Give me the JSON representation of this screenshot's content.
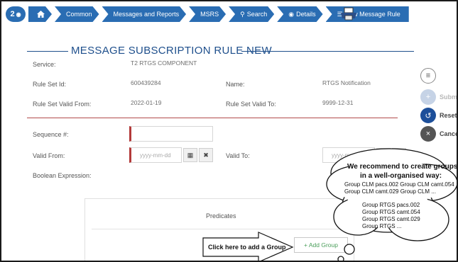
{
  "breadcrumb": {
    "step_number": "2",
    "items": [
      "Common",
      "Messages and Reports",
      "MSRS",
      "Search",
      "Details",
      "New Message Rule"
    ]
  },
  "page": {
    "title": "MESSAGE SUBSCRIPTION RULE NEW"
  },
  "fields": {
    "service_label": "Service:",
    "service_value": "T2 RTGS COMPONENT",
    "rule_set_id_label": "Rule Set Id:",
    "rule_set_id_value": "600439284",
    "name_label": "Name:",
    "name_value": "RTGS Notification",
    "valid_from_label": "Rule Set Valid From:",
    "valid_from_value": "2022-01-19",
    "valid_to_label": "Rule Set Valid To:",
    "valid_to_value": "9999-12-31",
    "sequence_label": "Sequence #:",
    "sequence_value": "",
    "rule_valid_from_label": "Valid From:",
    "rule_valid_from_placeholder": "yyyy-mm-dd",
    "rule_valid_to_label": "Valid To:",
    "rule_valid_to_placeholder": "yyyy-mm-dd",
    "boolean_expression_label": "Boolean Expression:"
  },
  "actions": {
    "submit": "Submit",
    "reset": "Reset",
    "cancel": "Cancel"
  },
  "predicates": {
    "title": "Predicates",
    "add_group": "+ Add Group"
  },
  "callout": {
    "arrow_text": "Click here to add a Group",
    "heading_line1": "We recommend to create groups",
    "heading_line2": "in a well-organised way:",
    "clm_line1": "Group CLM pacs.002    Group CLM camt.054",
    "clm_line2": "Group CLM camt.029   Group CLM ...",
    "rtgs_lines": [
      "Group RTGS pacs.002",
      "Group RTGS camt.054",
      "Group RTGS camt.029",
      "Group RTGS ..."
    ]
  },
  "colors": {
    "primary_blue": "#2a6db3",
    "title_blue": "#1e4f8c",
    "required_red": "#b33a3a",
    "add_green": "#4a9e5a"
  }
}
